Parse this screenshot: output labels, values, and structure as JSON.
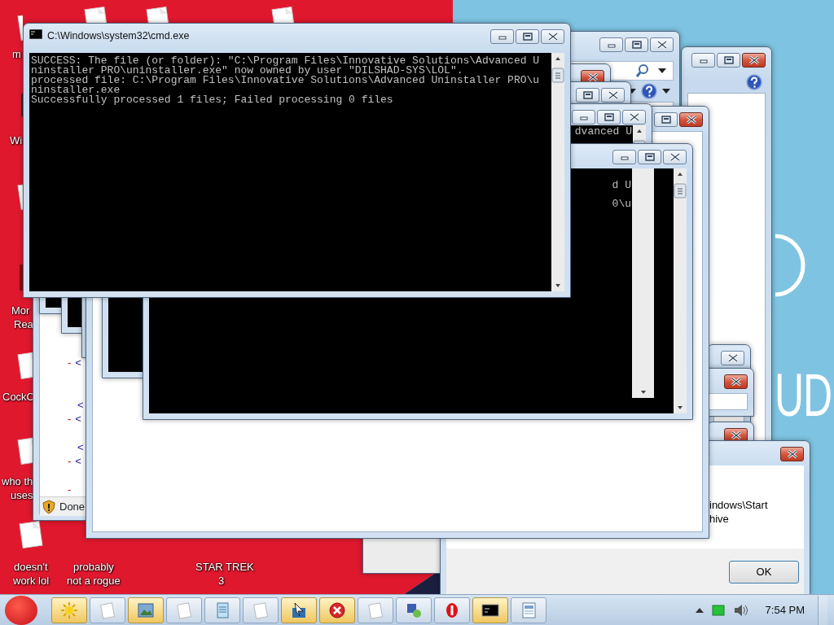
{
  "desktop": {
    "icons": [
      {
        "kind": "page"
      },
      {
        "kind": "page"
      },
      {
        "kind": "page"
      },
      {
        "kind": "page",
        "lines": [
          "m"
        ]
      },
      {
        "kind": "app",
        "lines": [
          "Wi"
        ]
      },
      {
        "kind": "page"
      },
      {
        "kind": "book",
        "lines": [
          "Mor",
          "Rea"
        ]
      },
      {
        "kind": "page",
        "lines": [
          "CockC"
        ]
      },
      {
        "kind": "page",
        "lines": [
          "who th",
          "uses"
        ]
      },
      {
        "kind": "page",
        "lines": [
          "doesn't",
          "work lol"
        ]
      },
      {
        "kind": "label",
        "lines": [
          "probably",
          "not a rogue"
        ]
      },
      {
        "kind": "label",
        "lines": [
          "STAR TREK",
          "3"
        ]
      }
    ],
    "wallpaper_text": "UD"
  },
  "windows": [
    {
      "kind": "explorer",
      "controls": [
        {
          "kind": "minimize"
        },
        {
          "kind": "maximize"
        },
        {
          "kind": "close",
          "highlighted": true
        }
      ],
      "help": true
    },
    {
      "kind": "dialog",
      "controls": [
        {
          "kind": "close",
          "highlighted": false
        }
      ]
    },
    {
      "kind": "dialog",
      "controls": [
        {
          "kind": "close",
          "highlighted": true
        }
      ]
    },
    {
      "kind": "dialog",
      "controls": [
        {
          "kind": "close",
          "highlighted": true
        }
      ]
    },
    {
      "kind": "panel"
    },
    {
      "kind": "message",
      "controls": [
        {
          "kind": "close",
          "highlighted": true
        }
      ],
      "lines": [
        "indows\\Start",
        "hive"
      ],
      "button": "OK"
    },
    {
      "kind": "browser",
      "rows": [
        {
          "marker": "-",
          "tag": "<"
        },
        {
          "tag": "<"
        },
        {
          "marker": "-",
          "tag": "<"
        },
        {
          "tag": "<"
        },
        {
          "marker": "-",
          "tag": "<"
        },
        {
          "marker": "-"
        }
      ],
      "status": "Done"
    },
    {
      "kind": "console"
    },
    {
      "kind": "console"
    },
    {
      "kind": "console"
    },
    {
      "kind": "explorer",
      "controls": [
        {
          "kind": "minimize"
        },
        {
          "kind": "maximize"
        },
        {
          "kind": "close",
          "highlighted": false
        }
      ],
      "search": true,
      "help": true
    },
    {
      "kind": "dialog",
      "controls": [
        {
          "kind": "close",
          "highlighted": true
        }
      ]
    },
    {
      "kind": "dialog",
      "controls": [
        {
          "kind": "maximize"
        },
        {
          "kind": "close",
          "highlighted": false
        }
      ]
    },
    {
      "kind": "dialog",
      "controls": [
        {
          "kind": "maximize"
        },
        {
          "kind": "close",
          "highlighted": true
        }
      ]
    },
    {
      "kind": "console",
      "controls": [
        {
          "kind": "minimize"
        },
        {
          "kind": "maximize"
        },
        {
          "kind": "close",
          "highlighted": false
        }
      ],
      "lines": [
        "dvanced U"
      ]
    },
    {
      "kind": "console",
      "controls": [
        {
          "kind": "minimize"
        },
        {
          "kind": "maximize"
        },
        {
          "kind": "close",
          "highlighted": false
        }
      ],
      "lines": [
        "d U",
        "0\\u"
      ]
    },
    {
      "kind": "console",
      "title": "C:\\Windows\\system32\\cmd.exe",
      "controls": [
        {
          "kind": "minimize"
        },
        {
          "kind": "maximize"
        },
        {
          "kind": "close",
          "highlighted": false
        }
      ],
      "lines": [
        "SUCCESS: The file (or folder): \"C:\\Program Files\\Innovative Solutions\\Advanced U",
        "ninstaller PRO\\uninstaller.exe\" now owned by user \"DILSHAD-SYS\\LOL\".",
        "processed file: C:\\Program Files\\Innovative Solutions\\Advanced Uninstaller PRO\\u",
        "ninstaller.exe",
        "Successfully processed 1 files; Failed processing 0 files"
      ]
    }
  ],
  "taskbar": {
    "buttons": [
      {
        "kind": "sun",
        "highlighted": true
      },
      {
        "kind": "page",
        "highlighted": false
      },
      {
        "kind": "picture",
        "highlighted": true
      },
      {
        "kind": "page",
        "highlighted": false
      },
      {
        "kind": "notepad",
        "highlighted": false
      },
      {
        "kind": "page",
        "highlighted": false
      },
      {
        "kind": "installer",
        "highlighted": true
      },
      {
        "kind": "error",
        "highlighted": true
      },
      {
        "kind": "page",
        "highlighted": false
      },
      {
        "kind": "network",
        "highlighted": false
      },
      {
        "kind": "stop",
        "highlighted": false
      },
      {
        "kind": "console",
        "highlighted": true
      },
      {
        "kind": "document",
        "highlighted": false
      }
    ],
    "clock": "7:54 PM"
  }
}
